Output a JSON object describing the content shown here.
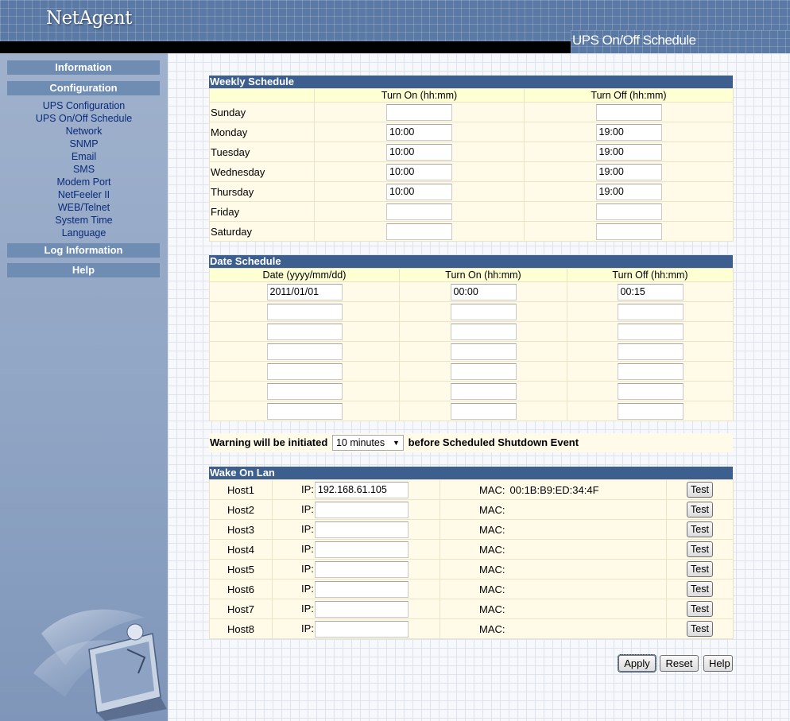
{
  "header": {
    "logo": "NetAgent",
    "page_title": "UPS On/Off Schedule"
  },
  "sidebar": {
    "sections": {
      "information": "Information",
      "configuration": "Configuration",
      "log_information": "Log Information",
      "help": "Help"
    },
    "config_items": [
      "UPS Configuration",
      "UPS On/Off Schedule",
      "Network",
      "SNMP",
      "Email",
      "SMS",
      "Modem Port",
      "NetFeeler II",
      "WEB/Telnet",
      "System Time",
      "Language"
    ]
  },
  "weekly": {
    "title": "Weekly Schedule",
    "col_on": "Turn On (hh:mm)",
    "col_off": "Turn Off (hh:mm)",
    "rows": [
      {
        "day": "Sunday",
        "on": "",
        "off": ""
      },
      {
        "day": "Monday",
        "on": "10:00",
        "off": "19:00"
      },
      {
        "day": "Tuesday",
        "on": "10:00",
        "off": "19:00"
      },
      {
        "day": "Wednesday",
        "on": "10:00",
        "off": "19:00"
      },
      {
        "day": "Thursday",
        "on": "10:00",
        "off": "19:00"
      },
      {
        "day": "Friday",
        "on": "",
        "off": ""
      },
      {
        "day": "Saturday",
        "on": "",
        "off": ""
      }
    ]
  },
  "date_schedule": {
    "title": "Date Schedule",
    "col_date": "Date (yyyy/mm/dd)",
    "col_on": "Turn On (hh:mm)",
    "col_off": "Turn Off (hh:mm)",
    "rows": [
      {
        "date": "2011/01/01",
        "on": "00:00",
        "off": "00:15"
      },
      {
        "date": "",
        "on": "",
        "off": ""
      },
      {
        "date": "",
        "on": "",
        "off": ""
      },
      {
        "date": "",
        "on": "",
        "off": ""
      },
      {
        "date": "",
        "on": "",
        "off": ""
      },
      {
        "date": "",
        "on": "",
        "off": ""
      },
      {
        "date": "",
        "on": "",
        "off": ""
      }
    ]
  },
  "warning": {
    "prefix": "Warning will be initiated",
    "selected": "10 minutes",
    "suffix": "before Scheduled Shutdown Event"
  },
  "wol": {
    "title": "Wake On Lan",
    "ip_label": "IP:",
    "mac_label": "MAC:",
    "test_label": "Test",
    "hosts": [
      {
        "name": "Host1",
        "ip": "192.168.61.105",
        "mac": "00:1B:B9:ED:34:4F"
      },
      {
        "name": "Host2",
        "ip": "",
        "mac": ""
      },
      {
        "name": "Host3",
        "ip": "",
        "mac": ""
      },
      {
        "name": "Host4",
        "ip": "",
        "mac": ""
      },
      {
        "name": "Host5",
        "ip": "",
        "mac": ""
      },
      {
        "name": "Host6",
        "ip": "",
        "mac": ""
      },
      {
        "name": "Host7",
        "ip": "",
        "mac": ""
      },
      {
        "name": "Host8",
        "ip": "",
        "mac": ""
      }
    ]
  },
  "actions": {
    "apply": "Apply",
    "reset": "Reset",
    "help": "Help"
  },
  "colors": {
    "header_blue": "#5a79a4",
    "panel_title": "#3c5f8f",
    "panel_bg": "#fffbe8",
    "link": "#0b2a7a"
  }
}
